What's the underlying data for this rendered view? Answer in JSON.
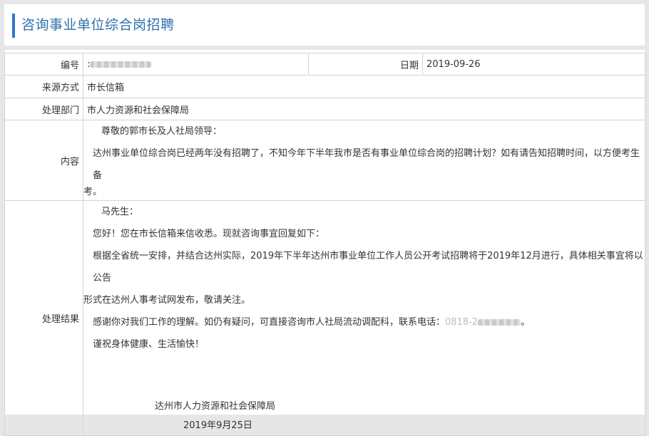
{
  "header": {
    "title": "咨询事业单位综合岗招聘"
  },
  "record": {
    "number_label": "编号",
    "number_prefix": ":",
    "date_label": "日期",
    "date_value": "2019-09-26",
    "source_label": "来源方式",
    "source_value": "市长信箱",
    "dept_label": "处理部门",
    "dept_value": "市人力资源和社会保障局",
    "content_label": "内容",
    "content_greeting": "尊敬的郭市长及人社局领导：",
    "content_body_line1": "达州事业单位综合岗已经两年没有招聘了，不知今年下半年我市是否有事业单位综合岗的招聘计划？如有请告知招聘时间，以方便考生备",
    "content_body_line2": "考。",
    "result_label": "处理结果",
    "result_greeting": "马先生：",
    "result_line1": "您好！您在市长信箱来信收悉。现就咨询事宜回复如下：",
    "result_line2a": "根据全省统一安排，并结合达州实际，2019年下半年达州市事业单位工作人员公开考试招聘将于2019年12月进行，具体相关事宜将以公告",
    "result_line2b": "形式在达州人事考试网发布，敬请关注。",
    "result_line3": "感谢你对我们工作的理解。如仍有疑问，可直接咨询市人社局流动调配科，联系电话：",
    "result_line3_phone_masked": "0818-2",
    "result_line3_end": "。",
    "result_line4": "谨祝身体健康、生活愉快！",
    "result_sign_org": "达州市人力资源和社会保障局",
    "result_sign_date": "2019年9月25日"
  }
}
